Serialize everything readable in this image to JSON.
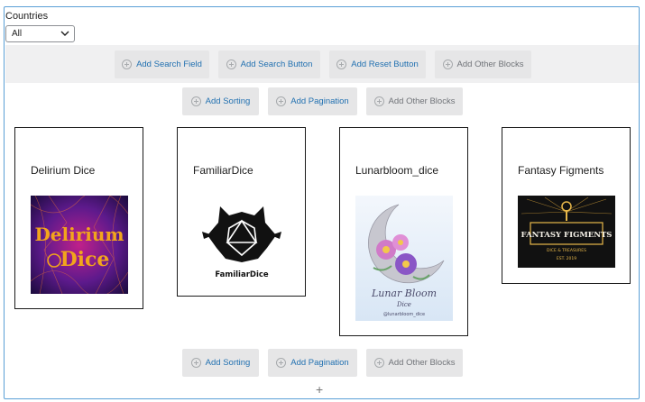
{
  "filter": {
    "label": "Countries",
    "selected": "All"
  },
  "top_toolbar": [
    {
      "label": "Add Search Field",
      "state": "active"
    },
    {
      "label": "Add Search Button",
      "state": "active"
    },
    {
      "label": "Add Reset Button",
      "state": "active"
    },
    {
      "label": "Add Other Blocks",
      "state": "muted"
    }
  ],
  "mid_toolbar": [
    {
      "label": "Add Sorting",
      "state": "active"
    },
    {
      "label": "Add Pagination",
      "state": "active"
    },
    {
      "label": "Add Other Blocks",
      "state": "muted"
    }
  ],
  "cards": [
    {
      "title": "Delirium Dice",
      "logo_text": [
        "Delirium",
        "Dice"
      ]
    },
    {
      "title": "FamiliarDice",
      "logo_text": [
        "FamiliarDice"
      ]
    },
    {
      "title": "Lunarbloom_dice",
      "logo_text": [
        "Lunar Bloom",
        "Dice",
        "@lunarbloom_dice"
      ]
    },
    {
      "title": "Fantasy Figments",
      "logo_text": [
        "FANTASY FIGMENTS",
        "DICE & TREASURES",
        "EST. 2019"
      ]
    }
  ],
  "bottom_toolbar": [
    {
      "label": "Add Sorting",
      "state": "active"
    },
    {
      "label": "Add Pagination",
      "state": "active"
    },
    {
      "label": "Add Other Blocks",
      "state": "muted"
    }
  ],
  "bottom_add_symbol": "+",
  "colors": {
    "frame_border": "#5aa0d6",
    "link_blue": "#2271b1",
    "muted_text": "#707378",
    "button_bg": "#e6e6e7",
    "band_bg": "#f0f0f1"
  }
}
